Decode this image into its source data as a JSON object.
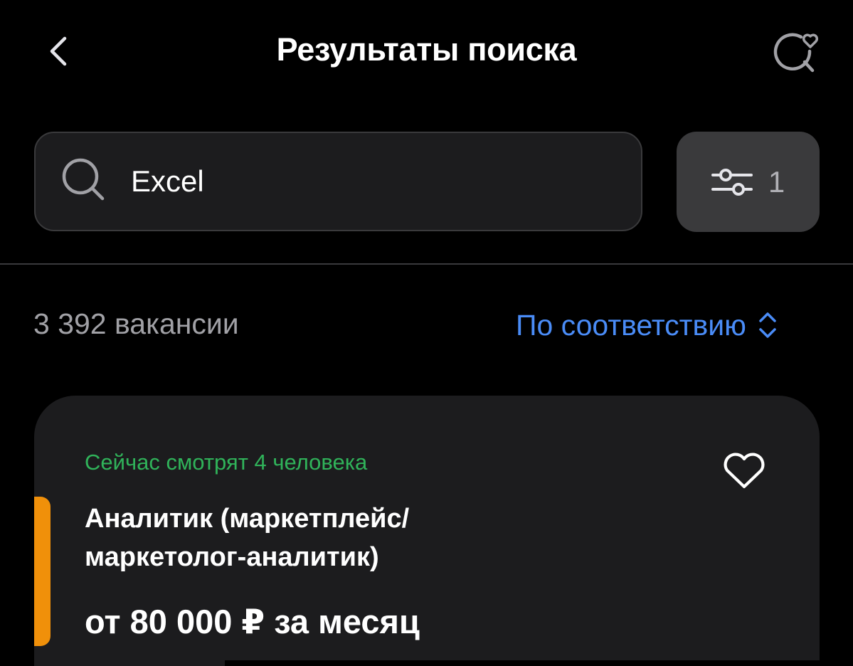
{
  "header": {
    "title": "Результаты поиска",
    "back_icon": "chevron-left-icon",
    "saved_search_icon": "search-heart-icon"
  },
  "search": {
    "value": "Excel",
    "icon": "search-icon"
  },
  "filter": {
    "icon": "sliders-icon",
    "count": "1"
  },
  "results": {
    "count_text": "3 392 вакансии",
    "sort_label": "По соответствию",
    "sort_icon": "chevron-up-down-icon"
  },
  "card": {
    "viewers_text": "Сейчас смотрят 4 человека",
    "title_line1": "Аналитик (маркетплейс/",
    "title_line2": "маркетолог-аналитик)",
    "salary": "от 80 000 ₽ за месяц",
    "favorite_icon": "heart-icon"
  },
  "colors": {
    "background": "#000000",
    "surface": "#1c1c1e",
    "accent_link": "#4a8cf7",
    "viewers_green": "#30b35a",
    "highlight_orange": "#f0900a"
  }
}
